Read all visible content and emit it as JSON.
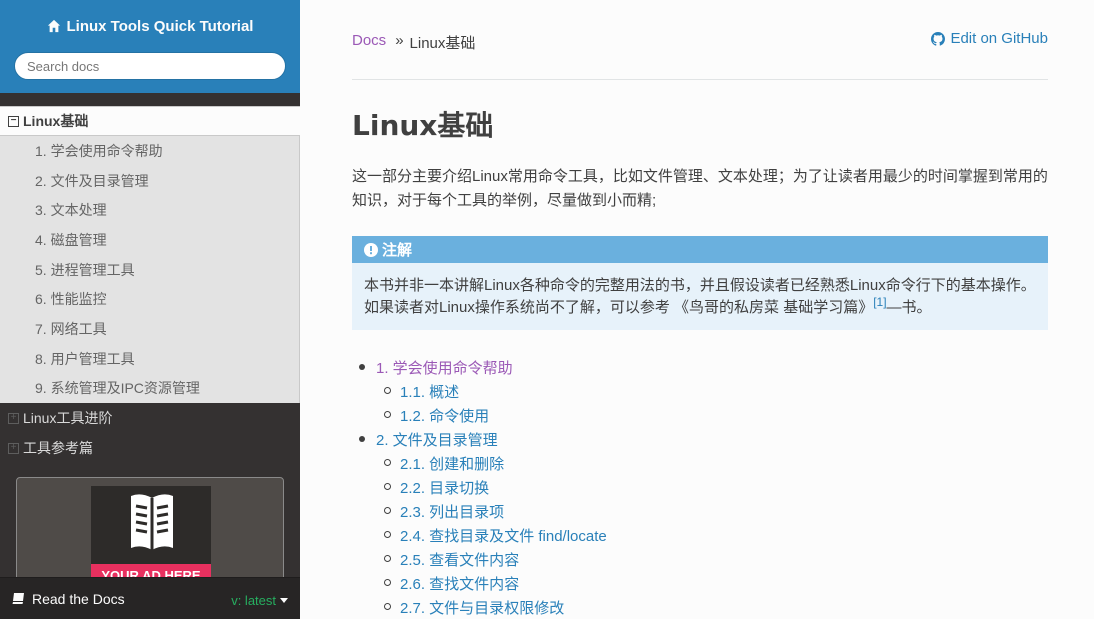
{
  "sidebar": {
    "project_title": "Linux Tools Quick Tutorial",
    "search_placeholder": "Search docs",
    "current_section": "Linux基础",
    "sub_items": [
      "1. 学会使用命令帮助",
      "2. 文件及目录管理",
      "3. 文本处理",
      "4. 磁盘管理",
      "5. 进程管理工具",
      "6. 性能监控",
      "7. 网络工具",
      "8. 用户管理工具",
      "9. 系统管理及IPC资源管理"
    ],
    "collapsed_sections": [
      "Linux工具进阶",
      "工具参考篇"
    ],
    "ad_text": "YOUR AD HERE"
  },
  "rtd": {
    "label": "Read the Docs",
    "version": "v: latest"
  },
  "breadcrumb": {
    "root": "Docs",
    "separator": "»",
    "current": "Linux基础",
    "edit_link": "Edit on GitHub"
  },
  "page": {
    "title": "Linux基础",
    "intro": "这一部分主要介绍Linux常用命令工具，比如文件管理、文本处理；为了让读者用最少的时间掌握到常用的知识，对于每个工具的举例，尽量做到小而精;",
    "note": {
      "title": "注解",
      "body_before": "本书并非一本讲解Linux各种命令的完整用法的书，并且假设读者已经熟悉Linux命令行下的基本操作。如果读者对Linux操作系统尚不了解，可以参考 《鸟哥的私房菜 基础学习篇》",
      "footnote": "[1]",
      "body_after": "—书。"
    },
    "toc": [
      {
        "label": "1. 学会使用命令帮助",
        "visited": true,
        "children": [
          "1.1. 概述",
          "1.2. 命令使用"
        ]
      },
      {
        "label": "2. 文件及目录管理",
        "visited": false,
        "children": [
          "2.1. 创建和删除",
          "2.2. 目录切换",
          "2.3. 列出目录项",
          "2.4. 查找目录及文件 find/locate",
          "2.5. 查看文件内容",
          "2.6. 查找文件内容",
          "2.7. 文件与目录权限修改"
        ]
      }
    ]
  },
  "colors": {
    "sidebar_top": "#2980b9",
    "sidebar_bg": "#343131",
    "link": "#2980b9",
    "visited": "#9b59b6",
    "note_header": "#6ab0de",
    "note_bg": "#e7f2fa",
    "version": "#27ae60"
  }
}
